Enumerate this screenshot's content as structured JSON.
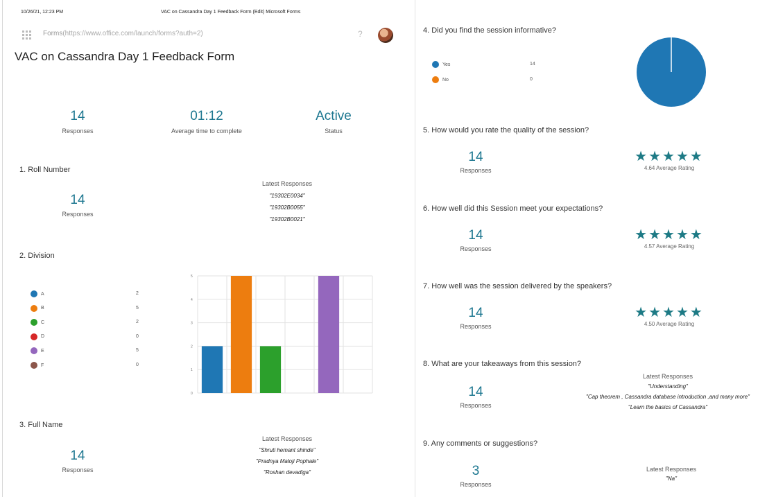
{
  "print_header": {
    "datetime": "10/26/21, 12:23 PM",
    "doc_title": "VAC on Cassandra Day 1 Feedback Form (Edit) Microsoft Forms"
  },
  "app": {
    "name": "Forms",
    "url": "(https://www.office.com/launch/forms?auth=2)",
    "help": "?"
  },
  "form_title": "VAC on Cassandra Day 1 Feedback Form",
  "summary": {
    "responses_value": "14",
    "responses_label": "Responses",
    "avg_time_value": "01:12",
    "avg_time_label": "Average time to complete",
    "status_value": "Active",
    "status_label": "Status"
  },
  "latest_label": "Latest Responses",
  "responses_label": "Responses",
  "q1": {
    "title": "1. Roll Number",
    "count": "14",
    "responses": [
      "\"19302E0034\"",
      "\"19302B0055\"",
      "\"19302B0021\""
    ]
  },
  "q2": {
    "title": "2. Division",
    "legend": [
      {
        "label": "A",
        "count": "2",
        "color": "#1f77b4"
      },
      {
        "label": "B",
        "count": "5",
        "color": "#ed7d0f"
      },
      {
        "label": "C",
        "count": "2",
        "color": "#2ca02c"
      },
      {
        "label": "D",
        "count": "0",
        "color": "#d62728"
      },
      {
        "label": "E",
        "count": "5",
        "color": "#9467bd"
      },
      {
        "label": "F",
        "count": "0",
        "color": "#8c564b"
      }
    ]
  },
  "q3": {
    "title": "3. Full Name",
    "count": "14",
    "responses": [
      "\"Shruti hemant shinde\"",
      "\"Pradnya Maloji Pophale\"",
      "\"Roshan devadiga\""
    ]
  },
  "q4": {
    "title": "4. Did you find the session informative?",
    "legend": [
      {
        "label": "Yes",
        "count": "14",
        "color": "#1f77b4"
      },
      {
        "label": "No",
        "count": "0",
        "color": "#ed7d0f"
      }
    ]
  },
  "q5": {
    "title": "5. How would you rate the quality of the session?",
    "count": "14",
    "stars": "★★★★★",
    "avg": "4.64 Average Rating",
    "rating": 4.64
  },
  "q6": {
    "title": "6. How well did this Session meet your expectations?",
    "count": "14",
    "stars": "★★★★★",
    "avg": "4.57 Average Rating",
    "rating": 4.57
  },
  "q7": {
    "title": "7. How well was the session delivered by the speakers?",
    "count": "14",
    "stars": "★★★★★",
    "avg": "4.50 Average Rating",
    "rating": 4.5
  },
  "q8": {
    "title": "8. What are your takeaways from this session?",
    "count": "14",
    "responses": [
      "\"Understanding\"",
      "\"Cap theorem , Cassandra database introduction ,and many more\"",
      "\"Learn the basics of Cassandra\""
    ]
  },
  "q9": {
    "title": "9. Any comments or suggestions?",
    "count": "3",
    "responses": [
      "\"Na\""
    ]
  },
  "chart_data": [
    {
      "type": "bar",
      "categories": [
        "A",
        "B",
        "C",
        "D",
        "E",
        "F"
      ],
      "values": [
        2,
        5,
        2,
        0,
        5,
        0
      ],
      "colors": [
        "#1f77b4",
        "#ed7d0f",
        "#2ca02c",
        "#d62728",
        "#9467bd",
        "#8c564b"
      ],
      "ylim": [
        0,
        5
      ],
      "yticks": [
        "0",
        "1",
        "2",
        "3",
        "4",
        "5"
      ],
      "grid": true
    },
    {
      "type": "pie",
      "categories": [
        "Yes",
        "No"
      ],
      "values": [
        14,
        0
      ],
      "colors": [
        "#1f77b4",
        "#ed7d0f"
      ]
    }
  ]
}
